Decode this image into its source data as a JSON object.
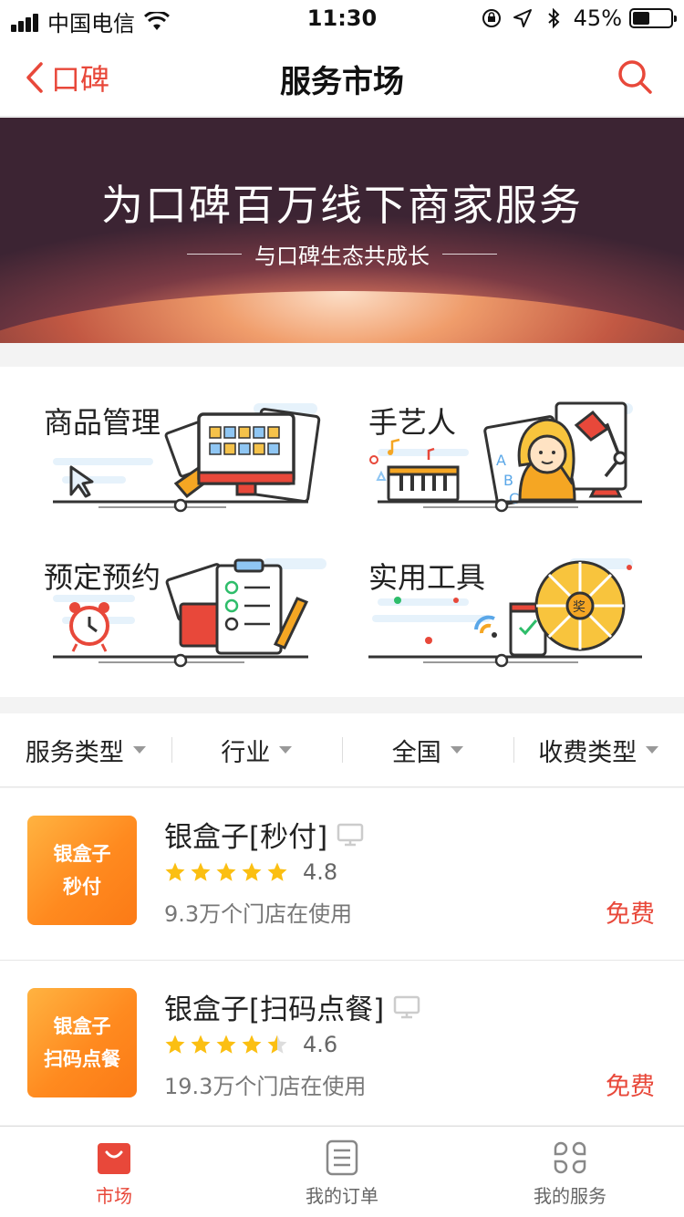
{
  "status_bar": {
    "carrier": "中国电信",
    "time": "11:30",
    "battery": "45%",
    "battery_level": 0.45
  },
  "nav": {
    "back_label": "口碑",
    "title": "服务市场",
    "search_icon": "search-icon"
  },
  "banner": {
    "title": "为口碑百万线下商家服务",
    "subtitle": "与口碑生态共成长"
  },
  "categories": [
    {
      "label": "商品管理",
      "icon": "product-management-illustration"
    },
    {
      "label": "手艺人",
      "icon": "artisan-illustration"
    },
    {
      "label": "预定预约",
      "icon": "reservation-illustration"
    },
    {
      "label": "实用工具",
      "icon": "tools-illustration"
    }
  ],
  "filters": [
    {
      "label": "服务类型"
    },
    {
      "label": "行业"
    },
    {
      "label": "全国"
    },
    {
      "label": "收费类型"
    }
  ],
  "items": [
    {
      "logo_line1": "银盒子",
      "logo_line2": "秒付",
      "title": "银盒子[秒付]",
      "rating": "4.8",
      "stars": 5,
      "usage": "9.3万个门店在使用",
      "price": "免费"
    },
    {
      "logo_line1": "银盒子",
      "logo_line2": "扫码点餐",
      "title": "银盒子[扫码点餐]",
      "rating": "4.6",
      "stars": 4.5,
      "usage": "19.3万个门店在使用",
      "price": "免费"
    }
  ],
  "tabs": [
    {
      "label": "市场",
      "active": true,
      "icon": "shopping-bag-icon"
    },
    {
      "label": "我的订单",
      "active": false,
      "icon": "order-list-icon"
    },
    {
      "label": "我的服务",
      "active": false,
      "icon": "services-grid-icon"
    }
  ],
  "colors": {
    "accent": "#e8483a",
    "star": "#fbbf12",
    "logo_orange": "#ff8a1f"
  }
}
